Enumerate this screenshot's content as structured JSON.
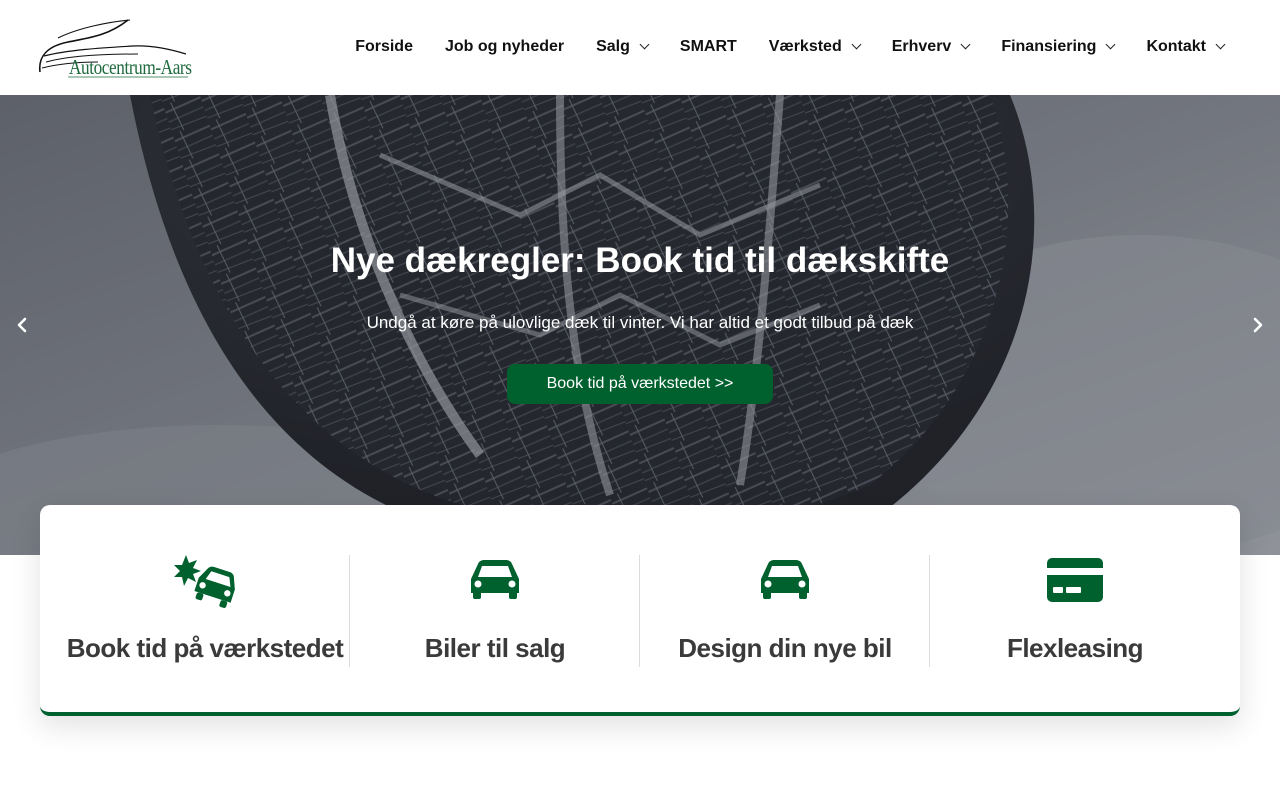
{
  "brand": {
    "name": "Autocentrum-Aars",
    "accent_color": "#00602e"
  },
  "nav": {
    "items": [
      {
        "label": "Forside",
        "has_dropdown": false
      },
      {
        "label": "Job og nyheder",
        "has_dropdown": false
      },
      {
        "label": "Salg",
        "has_dropdown": true
      },
      {
        "label": "SMART",
        "has_dropdown": false
      },
      {
        "label": "Værksted",
        "has_dropdown": true
      },
      {
        "label": "Erhverv",
        "has_dropdown": true
      },
      {
        "label": "Finansiering",
        "has_dropdown": true
      },
      {
        "label": "Kontakt",
        "has_dropdown": true
      }
    ]
  },
  "hero": {
    "title": "Nye dækregler: Book tid til dækskifte",
    "subtitle": "Undgå at køre på ulovlige dæk til vinter. Vi har altid et godt tilbud på dæk",
    "button_label": "Book tid på værkstedet >>",
    "prev_icon": "chevron-left-icon",
    "next_icon": "chevron-right-icon"
  },
  "features": [
    {
      "label": "Book tid på værkstedet",
      "icon": "car-crash-icon"
    },
    {
      "label": "Biler til salg",
      "icon": "car-icon"
    },
    {
      "label": "Design din nye bil",
      "icon": "car-icon"
    },
    {
      "label": "Flexleasing",
      "icon": "credit-card-icon"
    }
  ]
}
